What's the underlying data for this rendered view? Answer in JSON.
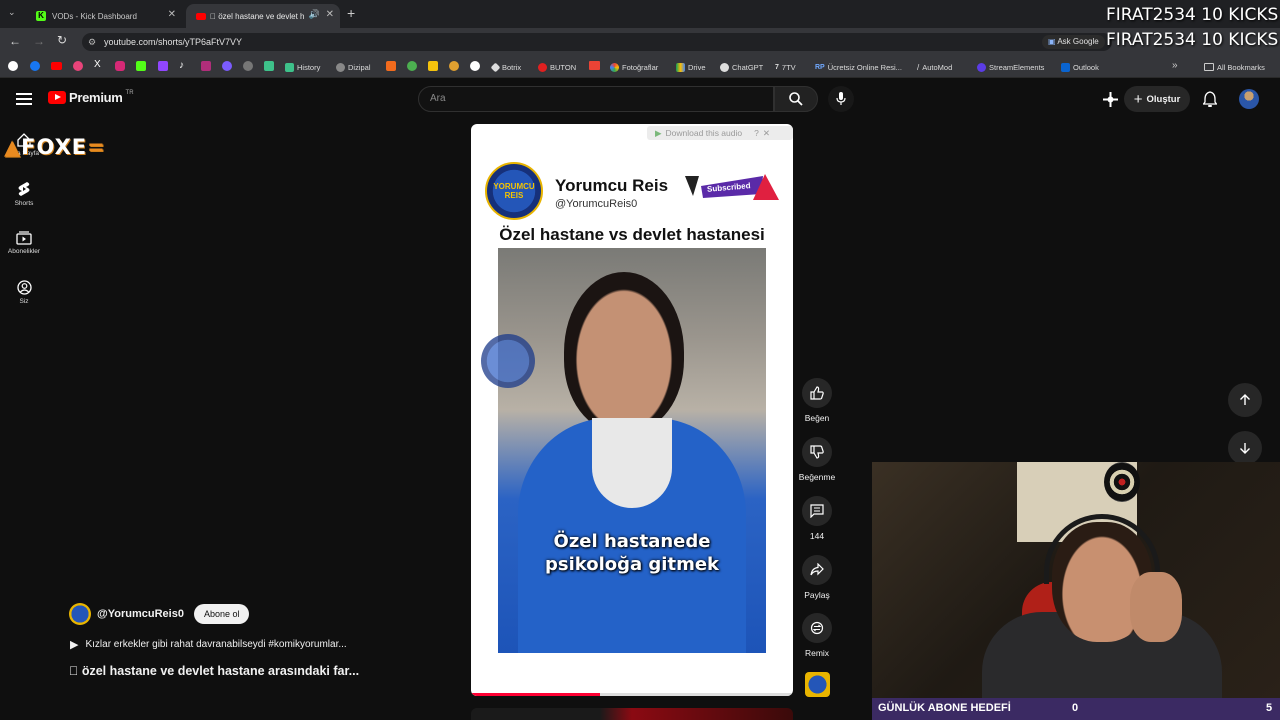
{
  "browser": {
    "tabs": [
      {
        "label": "VODs - Kick Dashboard"
      },
      {
        "label": "\u0000 özel hastane ve devlet h"
      }
    ],
    "url": "youtube.com/shorts/yTP6aFtV7VY",
    "ask_google": "Ask Google",
    "bookmarks": [
      "History",
      "Dizipal",
      "Botrix",
      "BUTON",
      "Fotoğraflar",
      "Drive",
      "ChatGPT",
      "7TV",
      "Ücretsiz Online Resi...",
      "AutoMod",
      "StreamElements",
      "Outlook"
    ],
    "all_bookmarks": "All Bookmarks"
  },
  "overlay": {
    "line1": "FIRAT2534  10 KICKS",
    "line2": "FIRAT2534  10 KICKS",
    "logo": "FOXE"
  },
  "youtube": {
    "brand": "Premium",
    "brand_sup": "TR",
    "search_placeholder": "Ara",
    "create_label": "Oluştur",
    "nav": [
      {
        "label": "Ana Sayfa"
      },
      {
        "label": "Shorts"
      },
      {
        "label": "Abonelikler"
      },
      {
        "label": "Siz"
      }
    ]
  },
  "short": {
    "download_audio": "Download this audio",
    "channel_display": "Yorumcu Reis",
    "channel_handle_in_video": "@YorumcuReis0",
    "subscribed_badge": "Subscribed",
    "video_title": "Özel hastane vs devlet hastanesi",
    "caption_line1": "Özel hastanede",
    "caption_line2": "psikoloğa gitmek",
    "logo_text": "YORUMCU REIS",
    "channel_handle": "@YorumcuReis0",
    "subscribe_label": "Abone ol",
    "playlist_text": "Kızlar erkekler gibi rahat davranabilseydi #komikyorumlar...",
    "title": "\u0000 özel hastane ve devlet hastane arasındaki far...",
    "progress": 0.4
  },
  "actions": {
    "like": "Beğen",
    "dislike": "Beğenme",
    "comments": "144",
    "share": "Paylaş",
    "remix": "Remix"
  },
  "stream": {
    "goal_label": "GÜNLÜK ABONE HEDEFİ",
    "goal_current": "0",
    "goal_target": "5"
  },
  "colors": {
    "yt_red": "#ff0000",
    "accent_blue": "#1c62b9",
    "goal_bar": "#3b2a63"
  }
}
